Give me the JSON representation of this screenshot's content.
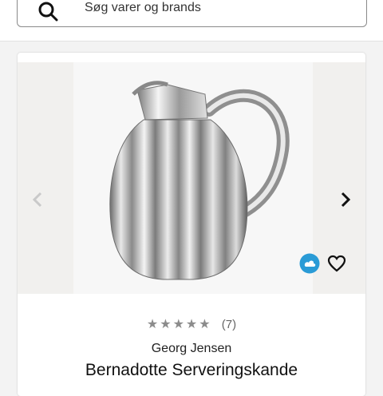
{
  "search": {
    "placeholder": "Søg varer og brands",
    "icon": "search-icon"
  },
  "product": {
    "rating_count": "(7)",
    "stars": 5,
    "brand": "Georg Jensen",
    "title": "Bernadotte Serveringskande",
    "icons": [
      "chevron-left-icon",
      "chevron-right-icon",
      "eco-cloud-icon",
      "heart-icon"
    ]
  },
  "colors": {
    "accent_eco": "#2a9bd6",
    "star": "#8c8c8c"
  }
}
